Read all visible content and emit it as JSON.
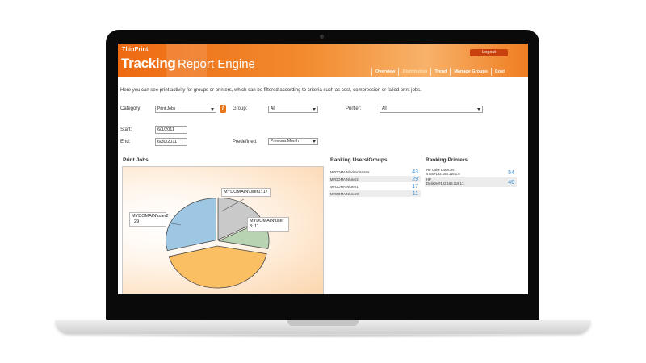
{
  "header": {
    "brand_small": "ThinPrint",
    "brand_tracking": "Tracking",
    "brand_report": "Report Engine",
    "logout_label": "Logout",
    "nav": [
      {
        "label": "Overview",
        "active": false
      },
      {
        "label": "Distribution",
        "active": true
      },
      {
        "label": "Trend",
        "active": false
      },
      {
        "label": "Manage Groups",
        "active": false
      },
      {
        "label": "Cost",
        "active": false
      }
    ]
  },
  "intro_text": "Here you can see print activity for groups or printers, which can be filtered according to criteria such as cost, compression or failed print jobs.",
  "filters": {
    "category_label": "Category:",
    "category_value": "Print Jobs",
    "info_icon": "i",
    "group_label": "Group:",
    "group_value": "All",
    "printer_label": "Printer:",
    "printer_value": "All",
    "start_label": "Start:",
    "start_value": "6/1/2011",
    "end_label": "End:",
    "end_value": "6/30/2011",
    "predefined_label": "Predefined:",
    "predefined_value": "Previous Month"
  },
  "print_jobs_title": "Print Jobs",
  "chart_data": {
    "type": "pie",
    "title": "Print Jobs",
    "slices": [
      {
        "label": "MYDOMAIN\\user1: 17",
        "name": "MYDOMAIN\\user1",
        "value": 17,
        "color": "#c9c9c9"
      },
      {
        "label": "MYDOMAIN\\user3: 11",
        "name": "MYDOMAIN\\user3",
        "value": 11,
        "color": "#b7d3b1"
      },
      {
        "label": "MYDOMAIN\\administrator",
        "name": "MYDOMAIN\\administrator",
        "value": 43,
        "color": "#fbbf63"
      },
      {
        "label": "MYDOMAIN\\user2 : 29",
        "name": "MYDOMAIN\\user2",
        "value": 29,
        "color": "#9ec7e4"
      }
    ],
    "labels": {
      "user1": "MYDOMAIN\\user1: 17",
      "user3": "MYDOMAIN\\user 3: 11",
      "user2": "MYDOMAIN\\user2 : 29"
    }
  },
  "ranking_users": {
    "title": "Ranking Users/Groups",
    "rows": [
      {
        "name": "MYDOMAIN\\administrator",
        "count": "43"
      },
      {
        "name": "MYDOMAIN\\user2",
        "count": "29"
      },
      {
        "name": "MYDOMAIN\\user1",
        "count": "17"
      },
      {
        "name": "MYDOMAIN\\user3",
        "count": "11"
      }
    ]
  },
  "ranking_printers": {
    "title": "Ranking Printers",
    "rows": [
      {
        "line1": "HP Color LaserJet",
        "line2": "4700#192.168.116.1:5",
        "count": "54"
      },
      {
        "line1": "HP",
        "line2": "DeskJet#192.168.116.1:1",
        "count": "46"
      }
    ]
  },
  "colors": {
    "header_orange": "#ee6a12",
    "accent_blue": "#3d8fd1",
    "logout_red": "#c9410c"
  }
}
